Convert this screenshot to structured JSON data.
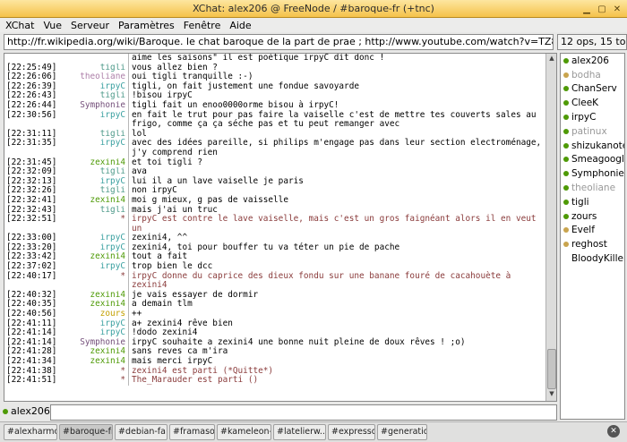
{
  "window": {
    "title": "XChat: alex206 @ FreeNode / #baroque-fr (+tnc)"
  },
  "menu": [
    "XChat",
    "Vue",
    "Serveur",
    "Paramètres",
    "Fenêtre",
    "Aide"
  ],
  "topic": {
    "text": "http://fr.wikipedia.org/wiki/Baroque. le chat baroque de la part de prae ; http://www.youtube.com/watch?v=TZ860P4iTaM"
  },
  "usercount": "12 ops, 15 to",
  "colors": {
    "tigli": "#4e9a8a",
    "theoliane": "#ad7fa8",
    "irpyC": "#3aa0a0",
    "Symphonie": "#75507b",
    "zexini4": "#4e9a06",
    "zours": "#c4a000",
    "star": "#8a3b3b"
  },
  "chat": [
    {
      "ts": "",
      "nick": "",
      "msg": "aime les saisons\" il est poétique irpyC dit donc !",
      "cls": "cont",
      "color": "tigli"
    },
    {
      "ts": "[22:25:49]",
      "nick": "tigli",
      "msg": "vous allez bien ?",
      "color": "tigli"
    },
    {
      "ts": "[22:26:06]",
      "nick": "theoliane",
      "msg": "oui tigli tranquille :-)",
      "color": "theoliane"
    },
    {
      "ts": "[22:26:39]",
      "nick": "irpyC",
      "msg": "tigli, on fait justement une fondue savoyarde",
      "color": "irpyC"
    },
    {
      "ts": "[22:26:43]",
      "nick": "tigli",
      "msg": "!bisou irpyC",
      "color": "tigli"
    },
    {
      "ts": "[22:26:44]",
      "nick": "Symphonie",
      "msg": "tigli fait un enoo0000orme bisou à irpyC!",
      "color": "Symphonie"
    },
    {
      "ts": "[22:30:56]",
      "nick": "irpyC",
      "msg": "en fait le trut pour pas faire la vaiselle c'est de mettre tes couverts sales au",
      "color": "irpyC"
    },
    {
      "ts": "",
      "nick": "",
      "msg": "frigo, comme ça ça séche pas et tu peut remanger avec",
      "cls": "cont",
      "color": "irpyC"
    },
    {
      "ts": "[22:31:11]",
      "nick": "tigli",
      "msg": "lol",
      "color": "tigli"
    },
    {
      "ts": "[22:31:35]",
      "nick": "irpyC",
      "msg": "avec des idées pareille, si philips m'engage pas dans leur section electroménage,",
      "color": "irpyC"
    },
    {
      "ts": "",
      "nick": "",
      "msg": "j'y comprend rien",
      "cls": "cont",
      "color": "irpyC"
    },
    {
      "ts": "[22:31:45]",
      "nick": "zexini4",
      "msg": "et toi tigli ?",
      "color": "zexini4"
    },
    {
      "ts": "[22:32:09]",
      "nick": "tigli",
      "msg": "ava",
      "color": "tigli"
    },
    {
      "ts": "[22:32:13]",
      "nick": "irpyC",
      "msg": "lui il a un lave vaiselle je paris",
      "color": "irpyC"
    },
    {
      "ts": "[22:32:26]",
      "nick": "tigli",
      "msg": "non irpyC",
      "color": "tigli"
    },
    {
      "ts": "[22:32:41]",
      "nick": "zexini4",
      "msg": "moi g mieux, g pas de vaisselle",
      "color": "zexini4"
    },
    {
      "ts": "[22:32:43]",
      "nick": "tigli",
      "msg": "mais j'ai un truc",
      "color": "tigli"
    },
    {
      "ts": "[22:32:51]",
      "nick": "*",
      "msg": "irpyC est contre le lave vaiselle, mais c'est un gros faignéant alors il en veut un",
      "cls": "action",
      "color": "star"
    },
    {
      "ts": "[22:33:00]",
      "nick": "irpyC",
      "msg": "zexini4, ^^",
      "color": "irpyC"
    },
    {
      "ts": "[22:33:20]",
      "nick": "irpyC",
      "msg": "zexini4, toi pour bouffer tu va téter un pie de pache",
      "color": "irpyC"
    },
    {
      "ts": "[22:33:42]",
      "nick": "zexini4",
      "msg": "tout a fait",
      "color": "zexini4"
    },
    {
      "ts": "[22:37:02]",
      "nick": "irpyC",
      "msg": "trop bien le dcc",
      "color": "irpyC"
    },
    {
      "ts": "[22:40:17]",
      "nick": "*",
      "msg": "irpyC donne du caprice des dieux fondu sur une banane fouré de cacahouète à zexini4",
      "cls": "action",
      "color": "star"
    },
    {
      "ts": "[22:40:32]",
      "nick": "zexini4",
      "msg": "je vais essayer de dormir",
      "color": "zexini4"
    },
    {
      "ts": "[22:40:35]",
      "nick": "zexini4",
      "msg": "a demain tlm",
      "color": "zexini4"
    },
    {
      "ts": "[22:40:56]",
      "nick": "zours",
      "msg": "++",
      "color": "zours"
    },
    {
      "ts": "[22:41:11]",
      "nick": "irpyC",
      "msg": "a+ zexini4 rêve bien",
      "color": "irpyC"
    },
    {
      "ts": "[22:41:14]",
      "nick": "irpyC",
      "msg": "!dodo zexini4",
      "color": "irpyC"
    },
    {
      "ts": "[22:41:14]",
      "nick": "Symphonie",
      "msg": "irpyC souhaite a zexini4 une bonne nuit pleine de doux rêves ! ;o)",
      "color": "Symphonie"
    },
    {
      "ts": "[22:41:28]",
      "nick": "zexini4",
      "msg": "sans reves ca m'ira",
      "color": "zexini4"
    },
    {
      "ts": "[22:41:34]",
      "nick": "zexini4",
      "msg": "mais merci irpyC",
      "color": "zexini4"
    },
    {
      "ts": "[22:41:38]",
      "nick": "*",
      "msg": "zexini4 est parti (*Quitte*)",
      "cls": "action",
      "color": "star"
    },
    {
      "ts": "[22:41:51]",
      "nick": "*",
      "msg": "The_Marauder est parti ()",
      "cls": "action",
      "color": "star"
    }
  ],
  "users": [
    {
      "name": "alex206",
      "dot": "#4e9a06",
      "color": "#000"
    },
    {
      "name": "bodha",
      "dot": "#c9a44e",
      "color": "#999"
    },
    {
      "name": "ChanServ",
      "dot": "#4e9a06",
      "color": "#000"
    },
    {
      "name": "CleeK",
      "dot": "#4e9a06",
      "color": "#000"
    },
    {
      "name": "irpyC",
      "dot": "#4e9a06",
      "color": "#000"
    },
    {
      "name": "patinux",
      "dot": "#4e9a06",
      "color": "#999"
    },
    {
      "name": "shizukanotenshi",
      "dot": "#4e9a06",
      "color": "#000"
    },
    {
      "name": "Smeagoogle",
      "dot": "#4e9a06",
      "color": "#000"
    },
    {
      "name": "Symphonie",
      "dot": "#4e9a06",
      "color": "#000"
    },
    {
      "name": "theoliane",
      "dot": "#4e9a06",
      "color": "#999"
    },
    {
      "name": "tigli",
      "dot": "#4e9a06",
      "color": "#000"
    },
    {
      "name": "zours",
      "dot": "#4e9a06",
      "color": "#000"
    },
    {
      "name": "Evelf",
      "dot": "#c9a44e",
      "color": "#000"
    },
    {
      "name": "reghost",
      "dot": "#c9a44e",
      "color": "#000"
    },
    {
      "name": "BloodyKiller",
      "dot": "",
      "color": "#000"
    }
  ],
  "input": {
    "nick": "alex206",
    "value": ""
  },
  "tabs": [
    {
      "label": "#alexharmo..",
      "active": false
    },
    {
      "label": "#baroque-fr..",
      "active": true
    },
    {
      "label": "#debian-fa..",
      "active": false
    },
    {
      "label": "#framasoft",
      "active": false
    },
    {
      "label": "#kameleon-..",
      "active": false
    },
    {
      "label": "#latelierw..",
      "active": false
    },
    {
      "label": "#expresso",
      "active": false
    },
    {
      "label": "#generatio..",
      "active": false
    }
  ]
}
